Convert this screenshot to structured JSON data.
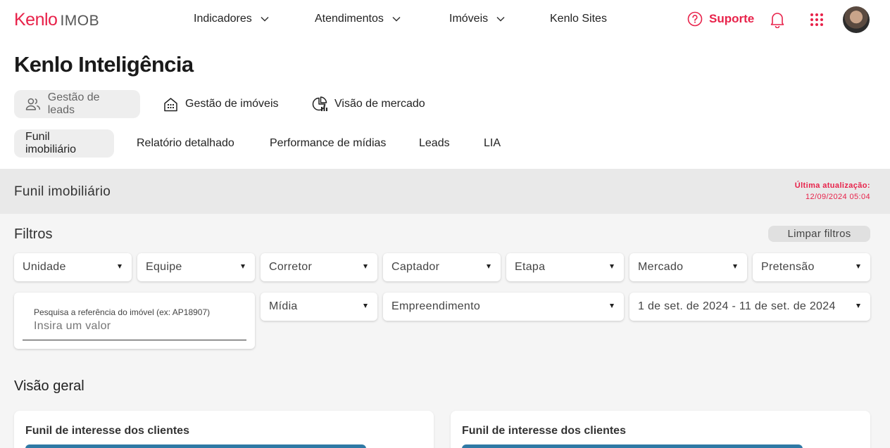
{
  "header": {
    "logo_brand": "Kenlo",
    "logo_product": "IMOB",
    "nav": [
      {
        "label": "Indicadores"
      },
      {
        "label": "Atendimentos"
      },
      {
        "label": "Imóveis"
      },
      {
        "label": "Kenlo Sites"
      }
    ],
    "support_label": "Suporte",
    "icons": [
      "help-circle-icon",
      "bell-icon",
      "apps-grid-icon",
      "avatar"
    ]
  },
  "page": {
    "title": "Kenlo Inteligência"
  },
  "primary_tabs": [
    {
      "label": "Gestão de leads",
      "icon": "users-icon",
      "active": true
    },
    {
      "label": "Gestão de imóveis",
      "icon": "building-icon",
      "active": false
    },
    {
      "label": "Visão de mercado",
      "icon": "chart-pie-icon",
      "active": false
    }
  ],
  "secondary_tabs": [
    {
      "label": "Funil imobiliário",
      "active": true
    },
    {
      "label": "Relatório detalhado",
      "active": false
    },
    {
      "label": "Performance de mídias",
      "active": false
    },
    {
      "label": "Leads",
      "active": false
    },
    {
      "label": "LIA",
      "active": false
    }
  ],
  "section": {
    "title": "Funil imobiliário",
    "last_update_label": "Última atualização:",
    "last_update_value": "12/09/2024 05:04"
  },
  "filters": {
    "title": "Filtros",
    "clear_label": "Limpar filtros",
    "row1": [
      "Unidade",
      "Equipe",
      "Corretor",
      "Captador",
      "Etapa",
      "Mercado",
      "Pretensão"
    ],
    "search_label": "Pesquisa a referência do imóvel (ex: AP18907)",
    "search_placeholder": "Insira um valor",
    "midia": "Mídia",
    "empreendimento": "Empreendimento",
    "date_range": "1 de set. de 2024 - 11 de set. de 2024"
  },
  "overview": {
    "title": "Visão geral",
    "cards": [
      {
        "title": "Funil de interesse dos clientes"
      },
      {
        "title": "Funil de interesse dos clientes"
      }
    ]
  },
  "colors": {
    "brand": "#e8224a",
    "bar": "#2f79a5"
  }
}
